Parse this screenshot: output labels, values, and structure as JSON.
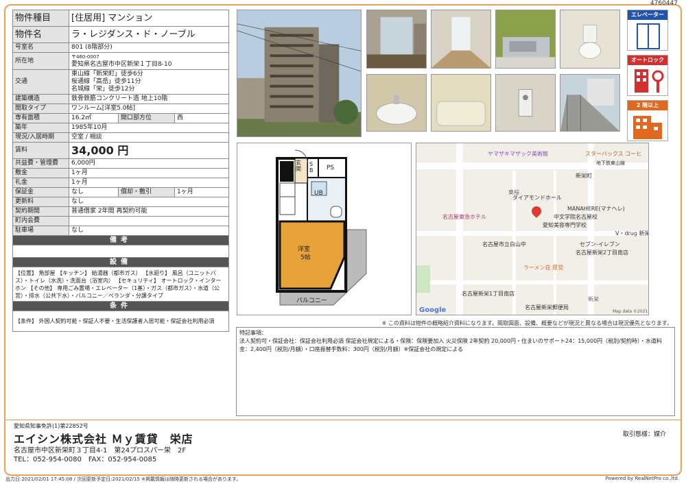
{
  "ref_id": "4760447",
  "spec": {
    "type_label": "物件種目",
    "type_value": "[住居用] マンション",
    "name_label": "物件名",
    "name_value": "ラ・レジダンス・ド・ノーブル",
    "room_label": "号室名",
    "room_value": "801 (8階部分)",
    "addr_label": "所在地",
    "zip": "〒460-0007",
    "addr_value": "愛知県名古屋市中区新栄１丁目8-10",
    "transit_label": "交通",
    "transit_1": "東山線「新栄町」徒歩6分",
    "transit_2": "桜通線「高岳」徒歩11分",
    "transit_3": "名城線「栄」徒歩12分",
    "structure_label": "建築構造",
    "structure_value": "鉄骨鉄筋コンクリート造 地上10階",
    "layout_label": "間取タイプ",
    "layout_value": "ワンルーム[洋室5.0帖]",
    "area_label": "専有面積",
    "area_value": "16.2㎡",
    "dir_label": "開口部方位",
    "dir_value": "西",
    "built_label": "築年",
    "built_value": "1985年10月",
    "status_label": "現況/入居時期",
    "status_value": "空室 / 相談",
    "rent_label": "賃料",
    "rent_value": "34,000 円",
    "fee_label": "共益費・管理費",
    "fee_value": "6,000円",
    "deposit_label": "敷金",
    "deposit_value": "1ヶ月",
    "key_label": "礼金",
    "key_value": "1ヶ月",
    "guarantee_label": "保証金",
    "guarantee_value": "なし",
    "depreciation_label": "償却・敷引",
    "depreciation_value": "1ヶ月",
    "renewal_label": "更新料",
    "renewal_value": "なし",
    "contract_label": "契約期間",
    "contract_value": "普通借家 2年間 再契約可能",
    "town_label": "町内会費",
    "town_value": "",
    "parking_label": "駐車場",
    "parking_value": "なし",
    "remarks_header": "備考",
    "remarks_value": "",
    "equip_header": "設備",
    "equip_value": "【位置】 角部屋 【キッチン】 給湯器（都市ガス） 【水廻り】 風呂（ユニットバス）・トイレ（水洗）・洗面台（浴室内） 【セキュリティ】 オートロック・インターホン 【その他】 専用ごみ置場・エレベーター（1基）・ガス（都市ガス）・水道（公営）・排水（公共下水）・バルコニー／ベランダ・分譲タイプ",
    "cond_header": "条件",
    "cond_value": "【条件】 外国人契約可能・保証人不要・生活保護者入居可能・保証会社利用必須"
  },
  "badges": {
    "elevator": "エレベーター",
    "autolock": "オートロック",
    "floor": "2 階以上"
  },
  "plan": {
    "genkan": "玄関",
    "sb": "S B",
    "ps": "PS",
    "ub": "UB",
    "room_1": "洋室",
    "room_2": "5帖",
    "balcony": "バルコニー"
  },
  "map": {
    "l1": "ヤマザキマザック美術館",
    "l2": "スターバックス コーヒ",
    "l3": "地下鉄東山線",
    "l4": "新栄町",
    "l5": "ダイアモンドホール",
    "l6": "MANAHERE(マナヘレ)",
    "l7": "名古屋東急ホテル",
    "l8": "中文学院名古屋校",
    "l9": "愛知美容専門学校",
    "l10": "V・drug 新栄",
    "l11": "名古屋市立白山中",
    "l12": "セブン-イレブン",
    "l13": "名古屋新栄2丁目南店",
    "l14": "ラーメン荘 厚党",
    "l15": "名古屋新栄1丁目南店",
    "l16": "名古屋新栄郵便局",
    "l17": "東桜",
    "l18": "新栄",
    "l19": "Map data ©2021",
    "google": "Google"
  },
  "note": "※ この資料は物件の概略紹介資料になります。間取図面、設備、概要などが現況と異なる場合は現況優先となります。",
  "tokki": {
    "title": "特記事項：",
    "body": "法人契約可・保証会社：保証会社利用必須 保証会社規定による・保険：保険要加入 火災保険 2年契約 20,000円・住まいのサポート24：15,000円（税別/契約時）・水道料金：2,400円（税別/月額）・口座振替手数料：300円（税別/月額）※保証会社の規定による"
  },
  "footer": {
    "license": "愛知県知事免許(1)第22852号",
    "company": "エイシン株式会社 Ｍｙ賃貸　栄店",
    "address": "名古屋市中区新栄町３丁目4-1　第24プロスパー栄　2F",
    "contact": "TEL：052-954-0080　FAX：052-954-0085",
    "torihiki": "取引態様：媒介",
    "bottom": "出力日:2021/02/01 17:45:08 / 次回更新予定日:2021/02/15 ※掲載情報は随時更新される場合があります。",
    "powered": "Powered by RealNetPro co.,ltd."
  }
}
